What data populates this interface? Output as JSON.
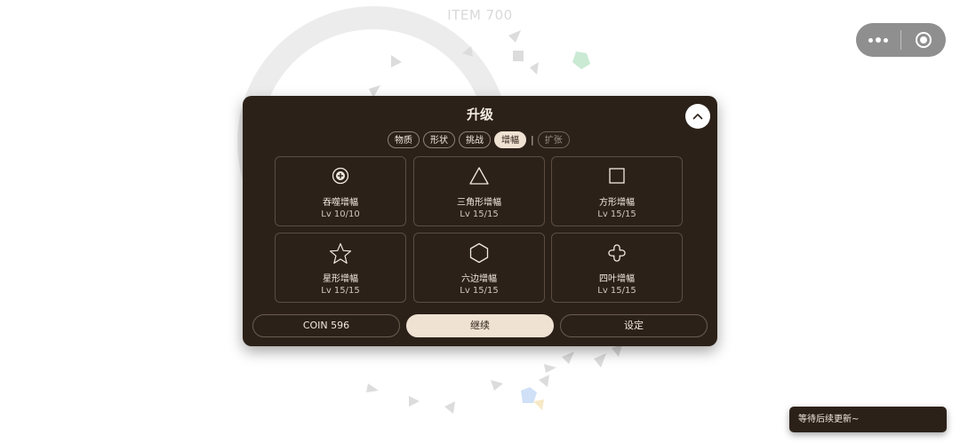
{
  "scene": {
    "item_label": "ITEM 700"
  },
  "capsule": {
    "more_icon": "ellipsis-icon",
    "close_icon": "target-circle-icon"
  },
  "dialog": {
    "title": "升级",
    "collapse_icon": "chevron-up-icon",
    "tabs": [
      {
        "label": "物质",
        "state": "normal"
      },
      {
        "label": "形状",
        "state": "normal"
      },
      {
        "label": "挑战",
        "state": "normal"
      },
      {
        "label": "增幅",
        "state": "active"
      },
      {
        "label": "扩张",
        "state": "disabled"
      }
    ],
    "tab_separator": "|",
    "upgrades": [
      {
        "icon": "plus-circle-icon",
        "name": "吞噬增幅",
        "level": "Lv 10/10"
      },
      {
        "icon": "triangle-icon",
        "name": "三角形增幅",
        "level": "Lv 15/15"
      },
      {
        "icon": "square-icon",
        "name": "方形增幅",
        "level": "Lv 15/15"
      },
      {
        "icon": "star-icon",
        "name": "星形增幅",
        "level": "Lv 15/15"
      },
      {
        "icon": "hexagon-icon",
        "name": "六边增幅",
        "level": "Lv 15/15"
      },
      {
        "icon": "four-leaf-icon",
        "name": "四叶增幅",
        "level": "Lv 15/15"
      }
    ],
    "buttons": {
      "coin": "COIN 596",
      "continue": "继续",
      "settings": "设定"
    }
  },
  "toast": {
    "text": "等待后续更新~"
  },
  "colors": {
    "panel_bg": "#2c2119",
    "accent_light": "#efe2d2",
    "card_border": "#5b4d42",
    "text_light": "#f1eadf"
  }
}
